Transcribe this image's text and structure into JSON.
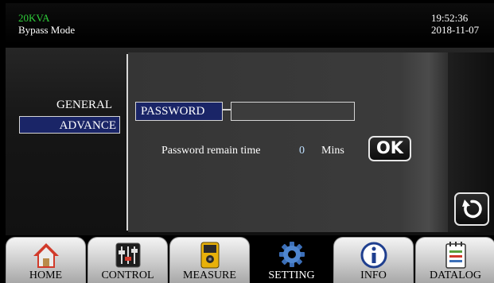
{
  "header": {
    "model": "20KVA",
    "mode": "Bypass Mode",
    "time": "19:52:36",
    "date": "2018-11-07"
  },
  "menu": {
    "general_label": "GENERAL",
    "advance_label": "ADVANCE",
    "selected": "ADVANCE"
  },
  "password": {
    "label": "PASSWORD",
    "value": ""
  },
  "remain": {
    "label": "Password remain time",
    "value": "0",
    "unit": "Mins"
  },
  "buttons": {
    "ok_label": "OK",
    "refresh_icon": "refresh-icon"
  },
  "nav": {
    "active": "SETTING",
    "tabs": [
      {
        "label": "HOME",
        "icon": "home-icon"
      },
      {
        "label": "CONTROL",
        "icon": "control-sliders-icon"
      },
      {
        "label": "MEASURE",
        "icon": "meter-icon"
      },
      {
        "label": "SETTING",
        "icon": "gear-icon"
      },
      {
        "label": "INFO",
        "icon": "info-icon"
      },
      {
        "label": "DATALOG",
        "icon": "log-icon"
      }
    ]
  },
  "colors": {
    "model_text": "#2fd13a",
    "selected_bg": "#1a2567",
    "active_tab_bg": "#000000"
  }
}
